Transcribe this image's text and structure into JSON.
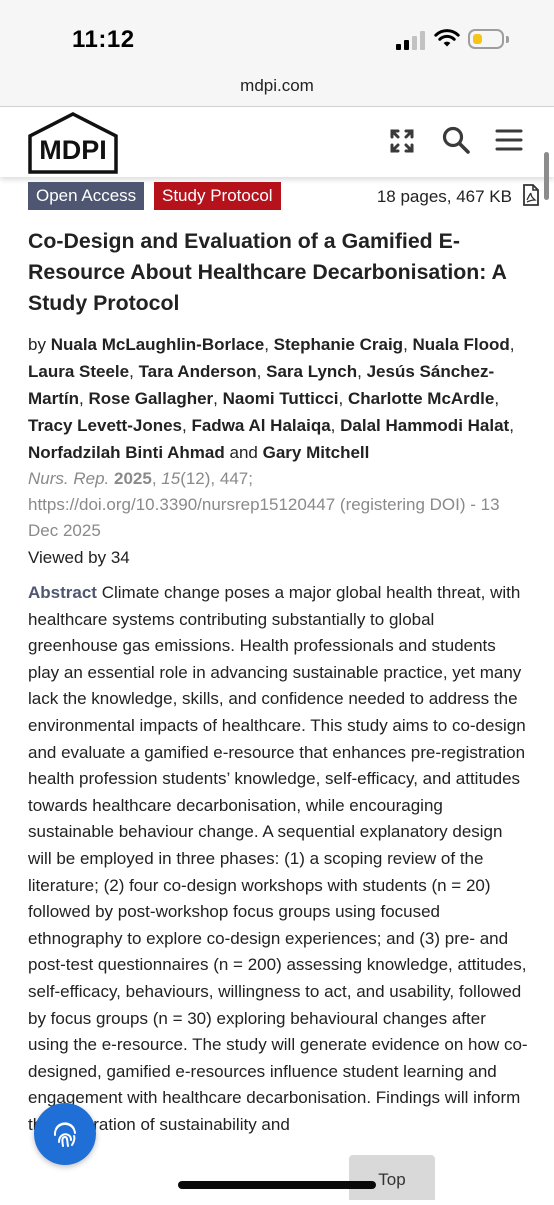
{
  "status_bar": {
    "time": "11:12"
  },
  "browser": {
    "url": "mdpi.com"
  },
  "header": {
    "logo_text": "MDPI",
    "icons": [
      "expand-icon",
      "search-icon",
      "menu-icon"
    ]
  },
  "article": {
    "badges": [
      "Open Access",
      "Study Protocol"
    ],
    "file_info": "18 pages, 467 KB",
    "title": "Co-Design and Evaluation of a Gamified E-Resource About Healthcare Decarbonisation: A Study Protocol",
    "by": "by",
    "authors": [
      "Nuala McLaughlin-Borlace",
      "Stephanie Craig",
      "Nuala Flood",
      "Laura Steele",
      "Tara Anderson",
      "Sara Lynch",
      "Jesús Sánchez-Martín",
      "Rose Gallagher",
      "Naomi Tutticci",
      "Charlotte McArdle",
      "Tracy Levett-Jones",
      "Fadwa Al Halaiqa",
      "Dalal Hammodi Halat",
      "Norfadzilah Binti Ahmad",
      "Gary Mitchell"
    ],
    "and": "and",
    "citation": {
      "journal": "Nurs. Rep.",
      "year": "2025",
      "volume": "15",
      "issue_pages": "(12), 447;",
      "doi": "https://doi.org/10.3390/nursrep15120447 (registering DOI) -",
      "date": "13 Dec 2025"
    },
    "viewed": "Viewed by 34",
    "abstract_label": "Abstract",
    "abstract_text": "Climate change poses a major global health threat, with healthcare systems contributing substantially to global greenhouse gas emissions. Health professionals and students play an essential role in advancing sustainable practice, yet many lack the knowledge, skills, and confidence needed to address the environmental impacts of healthcare. This study aims to co-design and evaluate a gamified e-resource that enhances pre-registration health profession students’ knowledge, self-efficacy, and attitudes towards healthcare decarbonisation, while encouraging sustainable behaviour change. A sequential explanatory design will be employed in three phases: (1) a scoping review of the literature; (2) four co-design workshops with students (n = 20) followed by post-workshop focus groups using focused ethnography to explore co-design experiences; and (3) pre- and post-test questionnaires (n = 200) assessing knowledge, attitudes, self-efficacy, behaviours, willingness to act, and usability, followed by focus groups (n = 30) exploring behavioural changes after using the e-resource. The study will generate evidence on how co-designed, gamified e-resources influence student learning and engagement with healthcare decarbonisation. Findings will inform the integration of sustainability and"
  },
  "floating": {
    "top_label": "Top"
  },
  "colors": {
    "open_access": "#4f5671",
    "study_protocol": "#b5121b",
    "fab": "#1f6fd6"
  }
}
